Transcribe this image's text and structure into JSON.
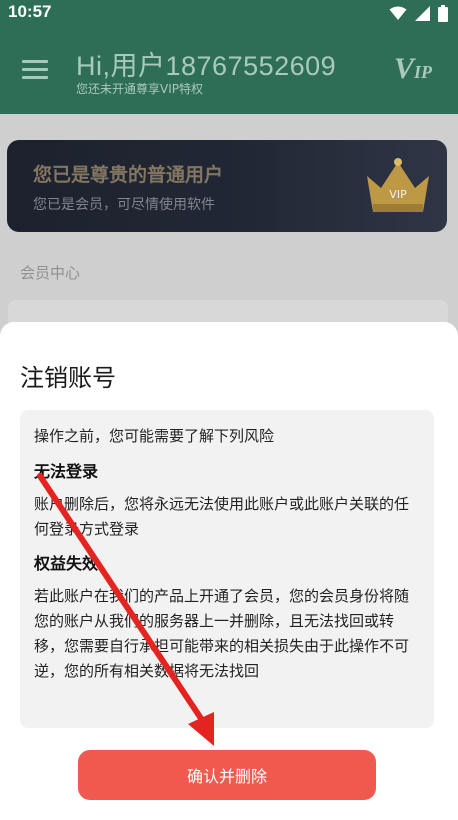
{
  "status_bar": {
    "time": "10:57",
    "icons": [
      "wifi-icon",
      "cellular-signal-icon",
      "battery-icon"
    ]
  },
  "app_bar": {
    "greeting": "Hi,用户18767552609",
    "vip_hint": "您还未开通尊享VIP特权",
    "vip_logo": "V",
    "vip_logo_small": "IP",
    "color": "#2e6e57"
  },
  "member_card": {
    "title": "您已是尊贵的普通用户",
    "subtitle": "您已是会员，可尽情使用软件",
    "badge_text": "VIP"
  },
  "section": {
    "label": "会员中心"
  },
  "dialog": {
    "title": "注销账号",
    "intro": "操作之前，您可能需要了解下列风险",
    "risks": [
      {
        "heading": "无法登录",
        "text": "账户删除后，您将永远无法使用此账户或此账户关联的任何登录方式登录"
      },
      {
        "heading": "权益失效",
        "text": "若此账户在我们的产品上开通了会员，您的会员身份将随您的账户从我们的服务器上一并删除，且无法找回或转移，您需要自行承担可能带来的相关损失由于此操作不可逆，您的所有相关数据将无法找回"
      }
    ],
    "confirm_label": "确认并删除",
    "confirm_color": "#f05a4e"
  }
}
